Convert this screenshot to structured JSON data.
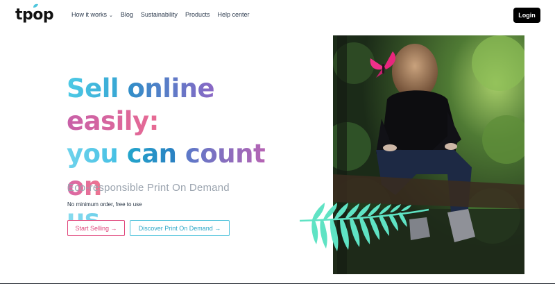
{
  "brand": {
    "logo_text": "tpop"
  },
  "nav": {
    "items": [
      {
        "label": "How it works",
        "has_dropdown": true
      },
      {
        "label": "Blog"
      },
      {
        "label": "Sustainability"
      },
      {
        "label": "Products"
      },
      {
        "label": "Help center"
      }
    ],
    "login_label": "Login"
  },
  "hero": {
    "headline": {
      "line1": [
        "Sell",
        "online",
        "easily:"
      ],
      "line2": [
        "you",
        "can",
        "count",
        "on"
      ],
      "line3": [
        "us"
      ]
    },
    "subtitle": "Eco-responsible Print On Demand",
    "note": "No minimum order, free to use",
    "primary_cta": "Start Selling →",
    "secondary_cta": "Discover Print On Demand →"
  },
  "colors": {
    "accent_pink": "#e0457b",
    "accent_cyan": "#49c0da",
    "login_bg": "#000000",
    "fern": "#5fe3c4",
    "butterfly": "#f0308a"
  },
  "icons": {
    "logo_leaf": "leaf-icon",
    "dropdown": "chevron-down-icon",
    "fern": "fern-leaf-illustration",
    "butterfly": "butterfly-illustration"
  }
}
